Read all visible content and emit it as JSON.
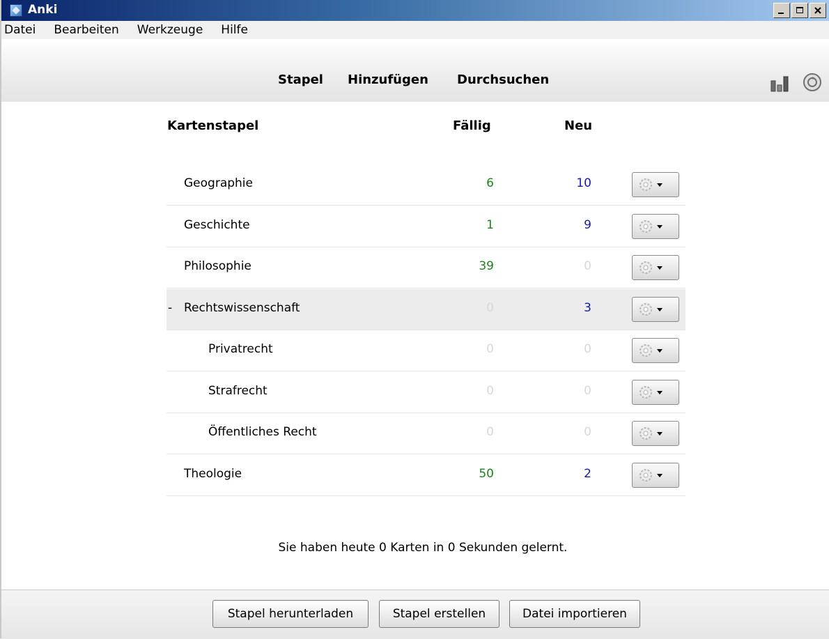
{
  "window": {
    "title": "Anki"
  },
  "menu": [
    {
      "label": "Datei"
    },
    {
      "label": "Bearbeiten"
    },
    {
      "label": "Werkzeuge"
    },
    {
      "label": "Hilfe"
    }
  ],
  "toolbar": {
    "decks": "Stapel",
    "add": "Hinzufügen",
    "browse": "Durchsuchen"
  },
  "table": {
    "headers": {
      "deck": "Kartenstapel",
      "due": "Fällig",
      "new": "Neu"
    },
    "rows": [
      {
        "name": "Geographie",
        "due": "6",
        "new": "10"
      },
      {
        "name": "Geschichte",
        "due": "1",
        "new": "9"
      },
      {
        "name": "Philosophie",
        "due": "39",
        "new": "0"
      },
      {
        "name": "Rechtswissenschaft",
        "collapse": "-",
        "due": "0",
        "new": "3"
      },
      {
        "name": "Privatrecht",
        "due": "0",
        "new": "0"
      },
      {
        "name": "Strafrecht",
        "due": "0",
        "new": "0"
      },
      {
        "name": "Öffentliches Recht",
        "due": "0",
        "new": "0"
      },
      {
        "name": "Theologie",
        "due": "50",
        "new": "2"
      }
    ]
  },
  "status": {
    "studied": "Sie haben heute 0 Karten in 0 Sekunden gelernt."
  },
  "bottom": {
    "download": "Stapel herunterladen",
    "create": "Stapel erstellen",
    "import": "Datei importieren"
  },
  "colors": {
    "due": "#208020",
    "new": "#1a1aa0",
    "zero": "#d8d8d8",
    "title_bar": "#0a246a"
  },
  "icons": [
    "app-icon",
    "stats-icon",
    "sync-icon",
    "gear-icon",
    "minimize-icon",
    "maximize-icon",
    "close-icon"
  ]
}
